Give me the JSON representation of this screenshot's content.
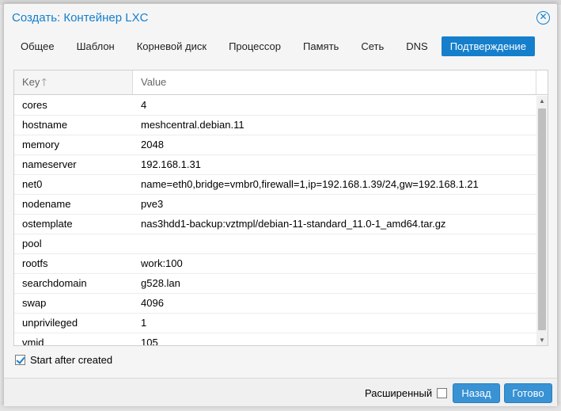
{
  "window": {
    "title": "Создать: Контейнер LXC"
  },
  "tabs": [
    "Общее",
    "Шаблон",
    "Корневой диск",
    "Процессор",
    "Память",
    "Сеть",
    "DNS",
    "Подтверждение"
  ],
  "active_tab": "Подтверждение",
  "grid": {
    "headers": {
      "key": "Key",
      "value": "Value"
    },
    "rows": [
      {
        "key": "cores",
        "value": "4"
      },
      {
        "key": "hostname",
        "value": "meshcentral.debian.11"
      },
      {
        "key": "memory",
        "value": "2048"
      },
      {
        "key": "nameserver",
        "value": "192.168.1.31"
      },
      {
        "key": "net0",
        "value": "name=eth0,bridge=vmbr0,firewall=1,ip=192.168.1.39/24,gw=192.168.1.21"
      },
      {
        "key": "nodename",
        "value": "pve3"
      },
      {
        "key": "ostemplate",
        "value": "nas3hdd1-backup:vztmpl/debian-11-standard_11.0-1_amd64.tar.gz"
      },
      {
        "key": "pool",
        "value": ""
      },
      {
        "key": "rootfs",
        "value": "work:100"
      },
      {
        "key": "searchdomain",
        "value": "g528.lan"
      },
      {
        "key": "swap",
        "value": "4096"
      },
      {
        "key": "unprivileged",
        "value": "1"
      },
      {
        "key": "vmid",
        "value": "105"
      }
    ]
  },
  "start_after_created": {
    "label": "Start after created",
    "checked": true
  },
  "footer": {
    "advanced_label": "Расширенный",
    "advanced_checked": false,
    "back_label": "Назад",
    "finish_label": "Готово"
  },
  "colors": {
    "accent": "#157fcc",
    "button": "#3892d4"
  }
}
